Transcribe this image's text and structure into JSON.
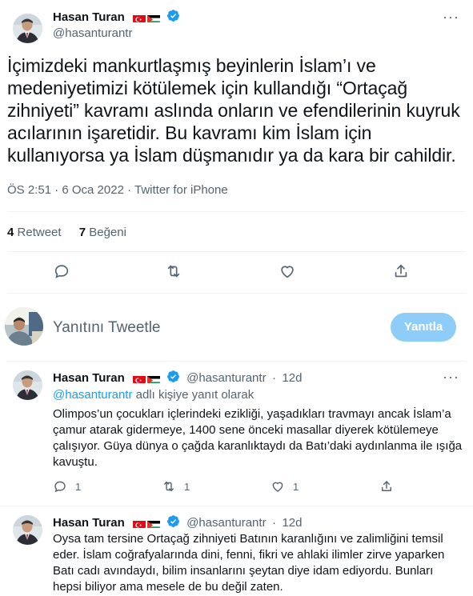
{
  "main_tweet": {
    "author_name": "Hasan Turan",
    "author_handle": "@hasanturantr",
    "text": "İçimizdeki mankurtlaşmış beyinlerin İslam’ı ve medeniyetimizi kötülemek için kullandığı “Ortaçağ zihniyeti” kavramı aslında onların ve efendilerinin kuyruk acılarının işaretidir. Bu kavramı kim İslam için kullanıyorsa ya İslam düşmanıdır ya da kara bir cahildir.",
    "meta": "ÖS 2:51 · 6 Oca 2022 · Twitter for iPhone",
    "retweet_count": "4",
    "retweet_label": "Retweet",
    "like_count": "7",
    "like_label": "Beğeni"
  },
  "reply_box": {
    "placeholder": "Yanıtını Tweetle",
    "button_label": "Yanıtla"
  },
  "replies": [
    {
      "author_name": "Hasan Turan",
      "author_handle": "@hasanturantr",
      "separator": "·",
      "time": "12d",
      "replying_handle": "@hasanturantr",
      "replying_suffix": "adlı kişiye yanıt olarak",
      "text": "Olimpos’un çocukları içlerindeki ezikliği, yaşadıkları travmayı ancak İslam’a çamur atarak gidermeye, 1400 sene önceki masallar diyerek kötülemeye çalışıyor. Güya dünya o çağda karanlıktaydı da Batı’daki aydınlanma ile ışığa kavuştu.",
      "reply_count": "1",
      "retweet_count": "1",
      "like_count": "1"
    },
    {
      "author_name": "Hasan Turan",
      "author_handle": "@hasanturantr",
      "separator": "·",
      "time": "12d",
      "text": "Oysa tam tersine Ortaçağ zihniyeti Batının karanlığını ve zalimliğini temsil eder. İslam coğrafyalarında dini, fenni, fikri ve ahlaki ilimler zirve yaparken Batı cadı avındaydı, bilim insanlarını şeytan diye idam ediyordu. Bunları hepsi biliyor ama mesele de bu değil zaten."
    }
  ],
  "colors": {
    "accent": "#1d9bf0",
    "reply_button_disabled": "#8ecdf8",
    "secondary_text": "#536471",
    "divider": "#eff3f4"
  },
  "icons": [
    "turkey-flag-icon",
    "palestine-flag-icon",
    "verified-badge-icon",
    "more-icon",
    "reply-icon",
    "retweet-icon",
    "like-icon",
    "share-icon"
  ]
}
